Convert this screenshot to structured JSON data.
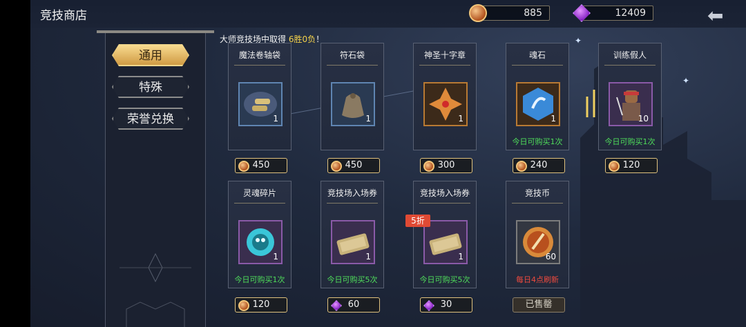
{
  "header": {
    "title": "竞技商店",
    "currency1": {
      "icon": "arena-coin-icon",
      "value": "885"
    },
    "currency2": {
      "icon": "magic-gem-icon",
      "value": "12409"
    },
    "back_icon": "back-arrow-icon"
  },
  "tabs": [
    {
      "label": "通用",
      "active": true
    },
    {
      "label": "特殊",
      "active": false
    },
    {
      "label": "荣誉兑换",
      "active": false
    }
  ],
  "banner": {
    "prefix": "大师竞技场中取得 ",
    "highlight": "6胜0负",
    "suffix": "！"
  },
  "items": [
    {
      "name": "魔法卷轴袋",
      "qty": "1",
      "note": "",
      "price": "450",
      "currency": "arena-coin"
    },
    {
      "name": "符石袋",
      "qty": "1",
      "note": "",
      "price": "450",
      "currency": "arena-coin"
    },
    {
      "name": "神圣十字章",
      "qty": "1",
      "note": "",
      "price": "300",
      "currency": "arena-coin"
    },
    {
      "name": "魂石",
      "qty": "1",
      "note": "今日可购买1次",
      "price": "240",
      "currency": "arena-coin"
    },
    {
      "name": "训练假人",
      "qty": "10",
      "note": "今日可购买1次",
      "price": "120",
      "currency": "arena-coin"
    },
    {
      "name": "灵魂碎片",
      "qty": "1",
      "note": "今日可购买1次",
      "price": "120",
      "currency": "arena-coin"
    },
    {
      "name": "竞技场入场券",
      "qty": "1",
      "note": "今日可购买5次",
      "price": "60",
      "currency": "magic-gem"
    },
    {
      "name": "竞技场入场券",
      "qty": "1",
      "note": "今日可购买5次",
      "price": "30",
      "currency": "magic-gem",
      "discount": "5折"
    },
    {
      "name": "竞技币",
      "qty": "60",
      "note": "每日4点刷新",
      "price": "已售罄",
      "currency": "none"
    }
  ],
  "colors": {
    "accent_gold": "#e0c27e",
    "available_green": "#4fdd5a",
    "refresh_red": "#ee4a3e"
  }
}
